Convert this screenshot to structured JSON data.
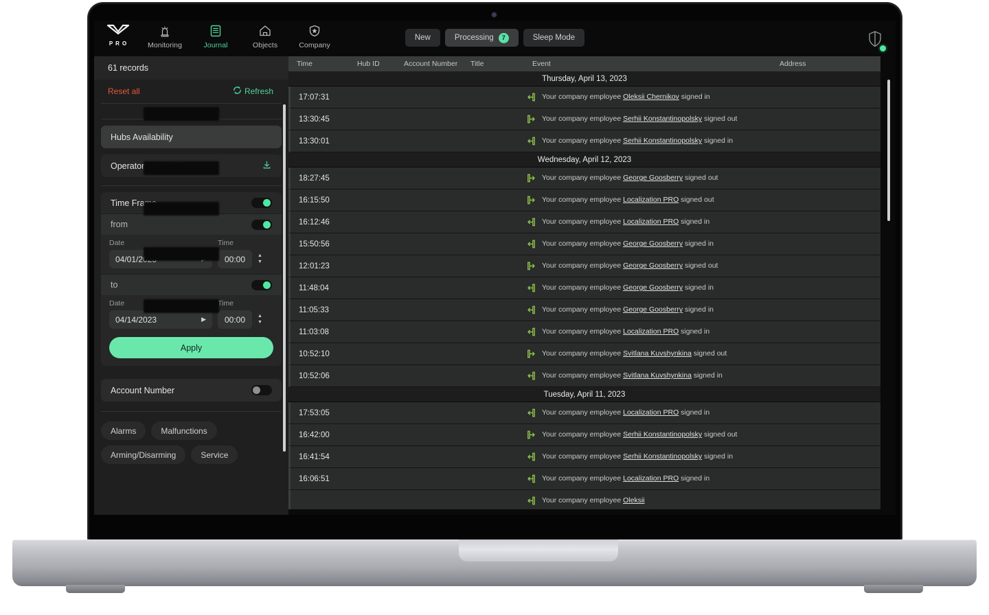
{
  "nav": {
    "brand": {
      "label": "PRO",
      "icon": "ajax-chevron-logo"
    },
    "items": [
      {
        "label": "Monitoring",
        "icon": "siren-icon",
        "active": false
      },
      {
        "label": "Journal",
        "icon": "journal-list-icon",
        "active": true
      },
      {
        "label": "Objects",
        "icon": "house-icon",
        "active": false
      },
      {
        "label": "Company",
        "icon": "shield-star-icon",
        "active": false
      }
    ],
    "segments": [
      {
        "label": "New",
        "selected": false,
        "badge": null
      },
      {
        "label": "Processing",
        "selected": true,
        "badge": "7"
      },
      {
        "label": "Sleep Mode",
        "selected": false,
        "badge": null
      }
    ],
    "right": {
      "icon": "shield-outline-icon",
      "status": "online-dot"
    }
  },
  "sidebar": {
    "records_count": "61 records",
    "reset_all": "Reset all",
    "refresh": "Refresh",
    "refresh_icon": "refresh-icon",
    "filters": [
      {
        "label": "Hubs Availability",
        "style": "lighter"
      },
      {
        "label": "Operators Availability",
        "style": "dark",
        "icon": "download-icon"
      }
    ],
    "time_frame": {
      "title": "Time Frame",
      "title_toggle": "on",
      "from_label": "from",
      "from_toggle": "on",
      "to_label": "to",
      "to_toggle": "on",
      "date_caption": "Date",
      "time_caption": "Time",
      "from_date": "04/01/2023",
      "from_time": "00:00",
      "to_date": "04/14/2023",
      "to_time": "00:00",
      "apply_label": "Apply"
    },
    "account_number": {
      "label": "Account Number",
      "toggle": "off"
    },
    "chips": [
      "Alarms",
      "Malfunctions",
      "Arming/Disarming",
      "Service"
    ]
  },
  "table": {
    "columns": [
      "Time",
      "Hub ID",
      "Account Number",
      "Title",
      "Event",
      "Address"
    ],
    "groups": [
      {
        "date": "Thursday, April 13, 2023",
        "rows": [
          {
            "time": "17:07:31",
            "icon": "sign-in-icon",
            "prefix": "Your company employee ",
            "name": "Oleksii Chernikov",
            "suffix": " signed in"
          },
          {
            "time": "13:30:45",
            "icon": "sign-out-icon",
            "prefix": "Your company employee ",
            "name": "Serhii Konstantinopolsky",
            "suffix": " signed out"
          },
          {
            "time": "13:30:01",
            "icon": "sign-in-icon",
            "prefix": "Your company employee ",
            "name": "Serhii Konstantinopolsky",
            "suffix": " signed in"
          }
        ]
      },
      {
        "date": "Wednesday, April 12, 2023",
        "rows": [
          {
            "time": "18:27:45",
            "icon": "sign-out-icon",
            "prefix": "Your company employee ",
            "name": "George Goosberry",
            "suffix": " signed out"
          },
          {
            "time": "16:15:50",
            "icon": "sign-out-icon",
            "prefix": "Your company employee ",
            "name": "Localization PRO",
            "suffix": " signed out"
          },
          {
            "time": "16:12:46",
            "icon": "sign-in-icon",
            "prefix": "Your company employee ",
            "name": "Localization PRO",
            "suffix": " signed in"
          },
          {
            "time": "15:50:56",
            "icon": "sign-in-icon",
            "prefix": "Your company employee ",
            "name": "George Goosberry",
            "suffix": " signed in"
          },
          {
            "time": "12:01:23",
            "icon": "sign-out-icon",
            "prefix": "Your company employee ",
            "name": "George Goosberry",
            "suffix": " signed out"
          },
          {
            "time": "11:48:04",
            "icon": "sign-in-icon",
            "prefix": "Your company employee ",
            "name": "George Goosberry",
            "suffix": " signed in"
          },
          {
            "time": "11:05:33",
            "icon": "sign-in-icon",
            "prefix": "Your company employee ",
            "name": "George Goosberry",
            "suffix": " signed in"
          },
          {
            "time": "11:03:08",
            "icon": "sign-in-icon",
            "prefix": "Your company employee ",
            "name": "Localization PRO",
            "suffix": " signed in"
          },
          {
            "time": "10:52:10",
            "icon": "sign-out-icon",
            "prefix": "Your company employee ",
            "name": "Svitlana Kuvshynkina",
            "suffix": " signed out"
          },
          {
            "time": "10:52:06",
            "icon": "sign-in-icon",
            "prefix": "Your company employee ",
            "name": "Svitlana Kuvshynkina",
            "suffix": " signed in"
          }
        ]
      },
      {
        "date": "Tuesday, April 11, 2023",
        "rows": [
          {
            "time": "17:53:05",
            "icon": "sign-in-icon",
            "prefix": "Your company employee ",
            "name": "Localization PRO",
            "suffix": " signed in"
          },
          {
            "time": "16:42:00",
            "icon": "sign-out-icon",
            "prefix": "Your company employee ",
            "name": "Serhii Konstantinopolsky",
            "suffix": " signed out"
          },
          {
            "time": "16:41:54",
            "icon": "sign-in-icon",
            "prefix": "Your company employee ",
            "name": "Serhii Konstantinopolsky",
            "suffix": " signed in"
          },
          {
            "time": "16:06:51",
            "icon": "sign-in-icon",
            "prefix": "Your company employee ",
            "name": "Localization PRO",
            "suffix": " signed in"
          },
          {
            "time": "",
            "icon": "sign-in-icon",
            "prefix": "Your company employee ",
            "name": "Oleksii",
            "suffix": ""
          }
        ]
      }
    ]
  },
  "colors": {
    "accent_green": "#4ee8a4",
    "reset_red": "#e4573d",
    "event_icon_green": "#8bc34a",
    "panel_bg": "#1f1f1f",
    "row_bg": "#2a2b2b"
  }
}
